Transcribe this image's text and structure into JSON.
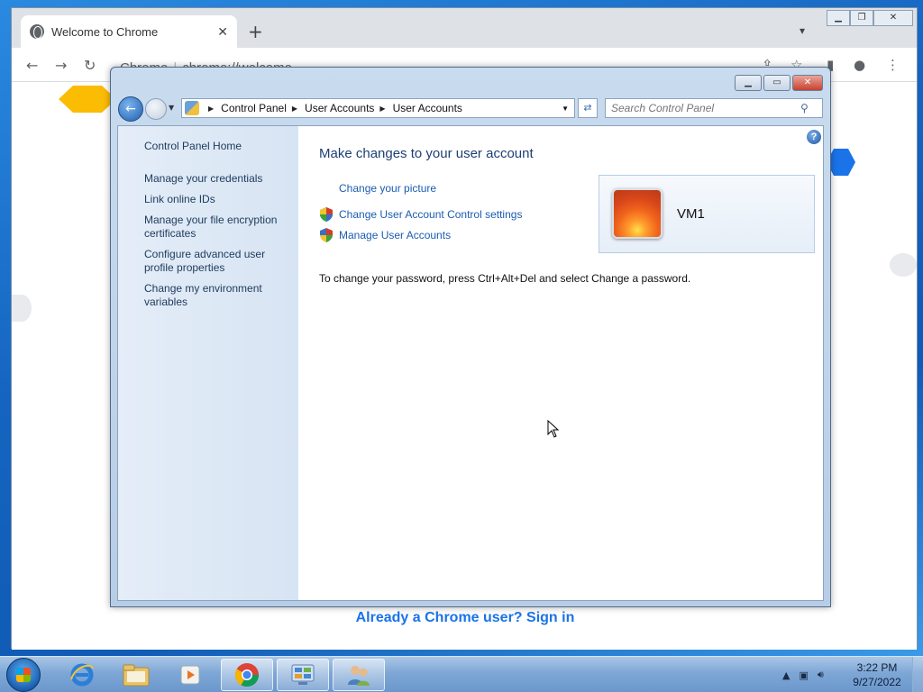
{
  "chrome": {
    "tab_title": "Welcome to Chrome",
    "tab_close": "✕",
    "new_tab": "+",
    "omnibox_site": "Chrome",
    "omnibox_url": "chrome://welcome",
    "signin_text": "Already a Chrome user? Sign in"
  },
  "control_panel": {
    "breadcrumbs": [
      "Control Panel",
      "User Accounts",
      "User Accounts"
    ],
    "search_placeholder": "Search Control Panel",
    "sidebar": {
      "home": "Control Panel Home",
      "items": [
        "Manage your credentials",
        "Link online IDs",
        "Manage your file encryption certificates",
        "Configure advanced user profile properties",
        "Change my environment variables"
      ]
    },
    "main": {
      "title": "Make changes to your user account",
      "tasks": [
        {
          "label": "Change your picture",
          "shield": false
        },
        {
          "label": "Change User Account Control settings",
          "shield": true
        },
        {
          "label": "Manage User Accounts",
          "shield": true
        }
      ],
      "user_name": "VM1",
      "password_note": "To change your password, press Ctrl+Alt+Del and select Change a password."
    },
    "help": "?"
  },
  "taskbar": {
    "apps": [
      "internet-explorer",
      "windows-explorer",
      "media-player",
      "google-chrome",
      "control-panel",
      "user-accounts"
    ],
    "clock_time": "3:22 PM",
    "clock_date": "9/27/2022"
  },
  "colors": {
    "link": "#1a5db0",
    "title": "#1e3f74",
    "chrome_blue": "#1a73e8"
  }
}
